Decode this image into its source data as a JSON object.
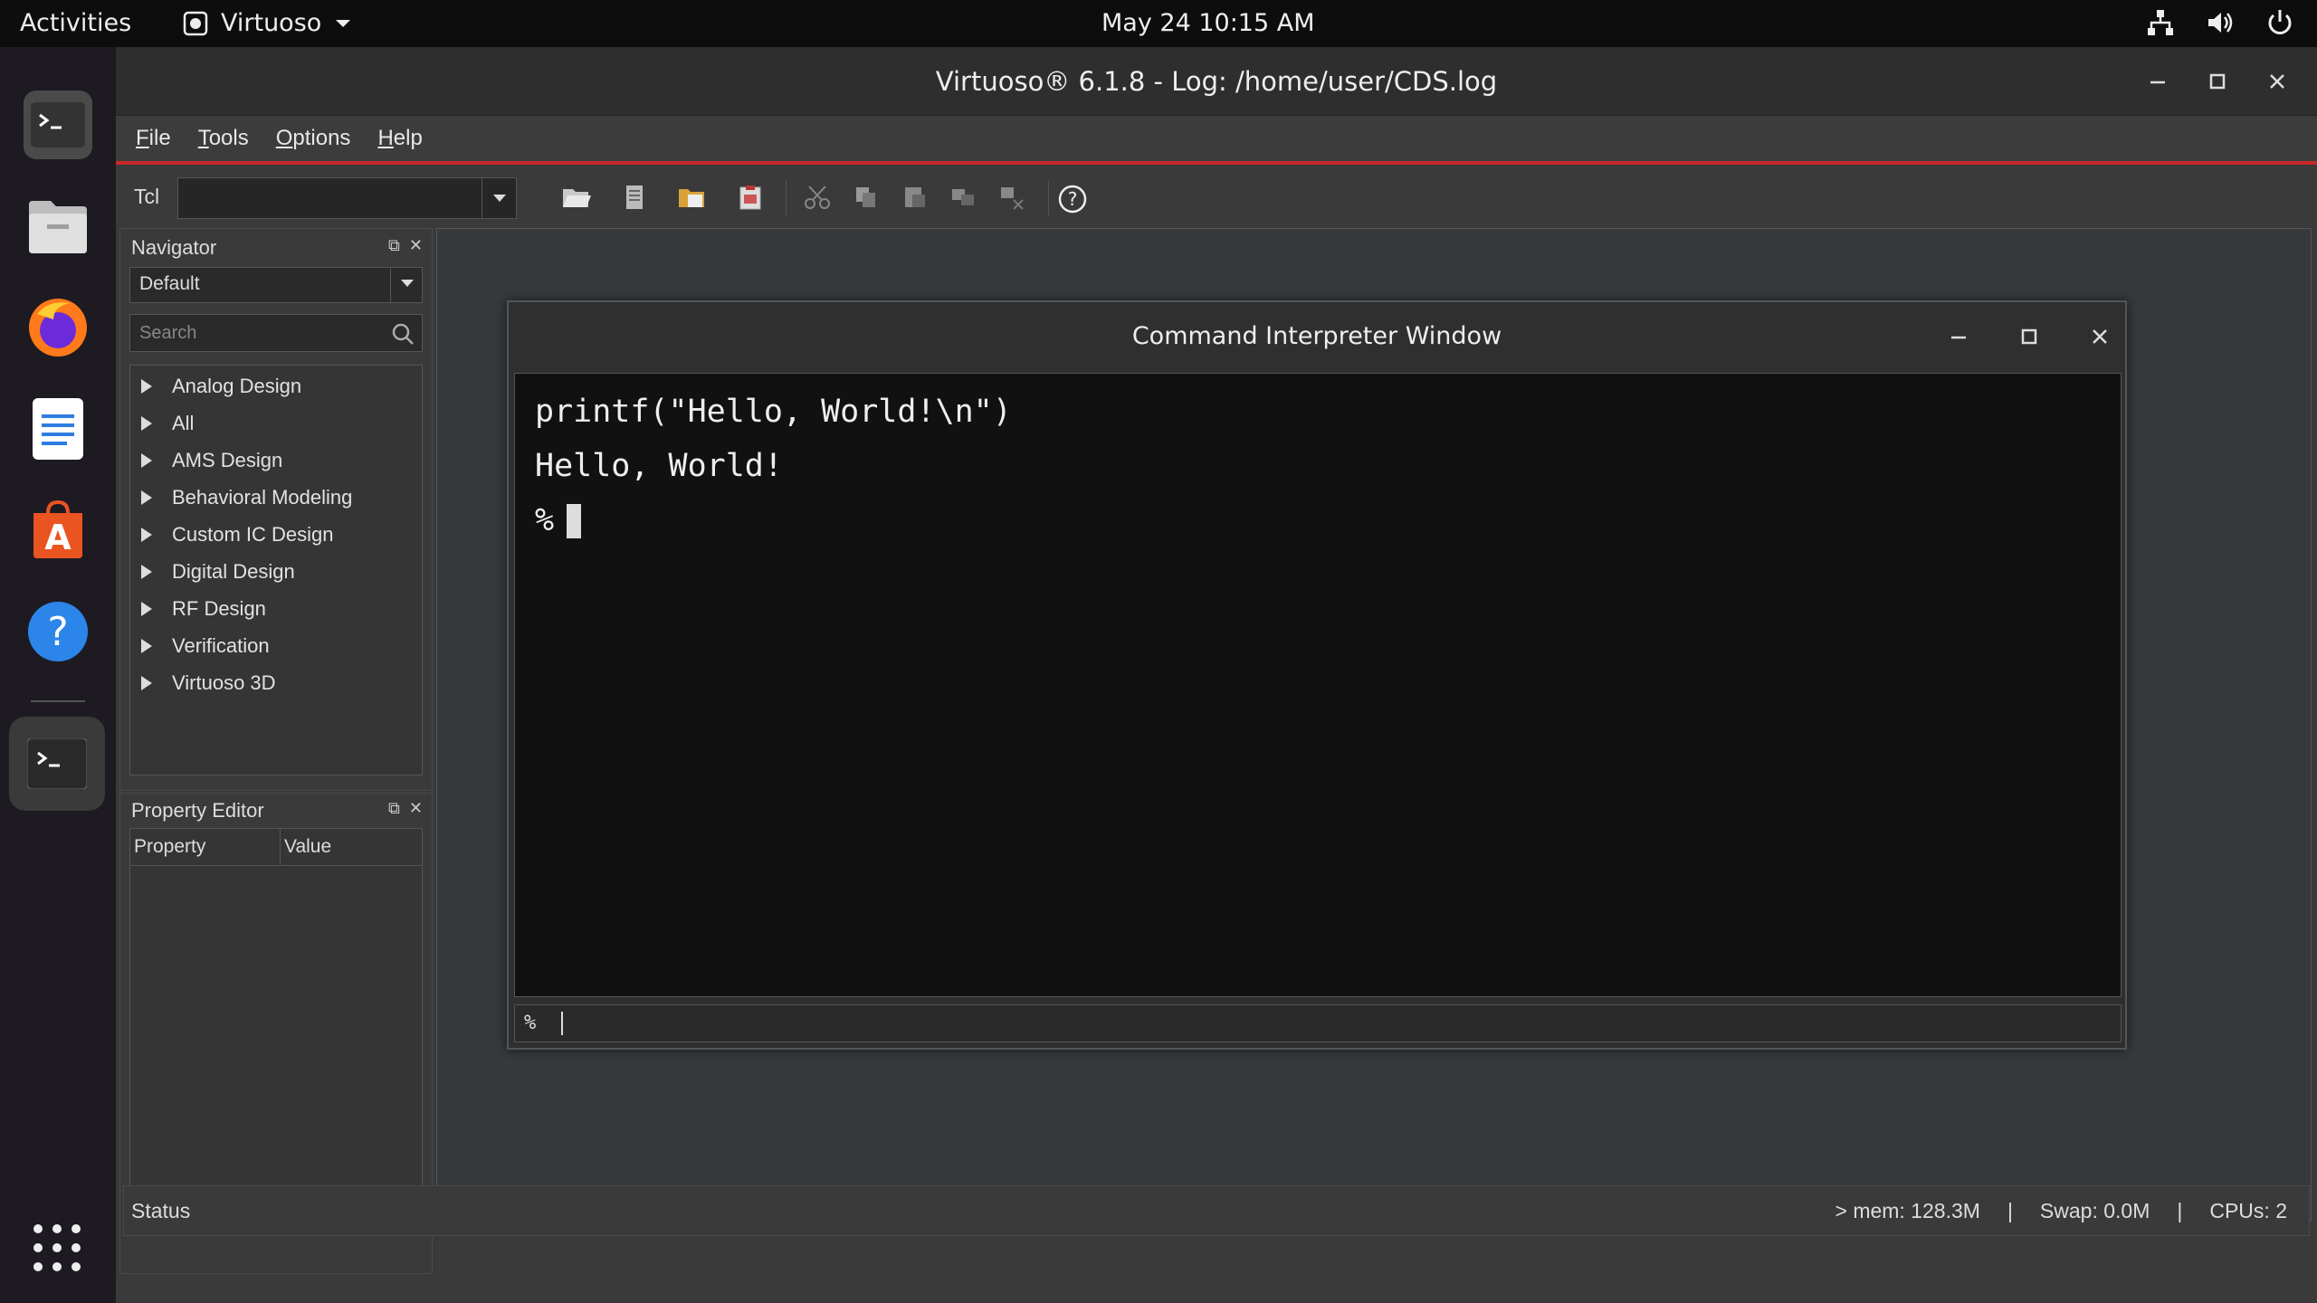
{
  "topbar": {
    "activities": "Activities",
    "app_name": "Virtuoso",
    "clock": "May 24  10:15 AM"
  },
  "window": {
    "title": "Virtuoso® 6.1.8 - Log: /home/user/CDS.log"
  },
  "menu": {
    "items": [
      "File",
      "Tools",
      "Options",
      "Help"
    ]
  },
  "toolbar": {
    "tcl_label": "Tcl"
  },
  "navigator": {
    "title": "Navigator",
    "combo_value": "Default",
    "search_placeholder": "Search",
    "items": [
      "Analog Design",
      "All",
      "AMS Design",
      "Behavioral Modeling",
      "Custom IC Design",
      "Digital Design",
      "RF Design",
      "Verification",
      "Virtuoso 3D"
    ]
  },
  "property_editor": {
    "title": "Property Editor",
    "col_property": "Property",
    "col_value": "Value"
  },
  "ciw": {
    "title": "Command Interpreter Window",
    "lines": [
      "printf(\"Hello, World!\\n\")",
      "Hello, World!"
    ],
    "prompt": "%",
    "cmd_prompt": "%"
  },
  "status": {
    "label": "Status",
    "mem": "> mem: 128.3M",
    "sep1": "|",
    "swap": "Swap: 0.0M",
    "sep2": "|",
    "cpus": "CPUs: 2"
  }
}
